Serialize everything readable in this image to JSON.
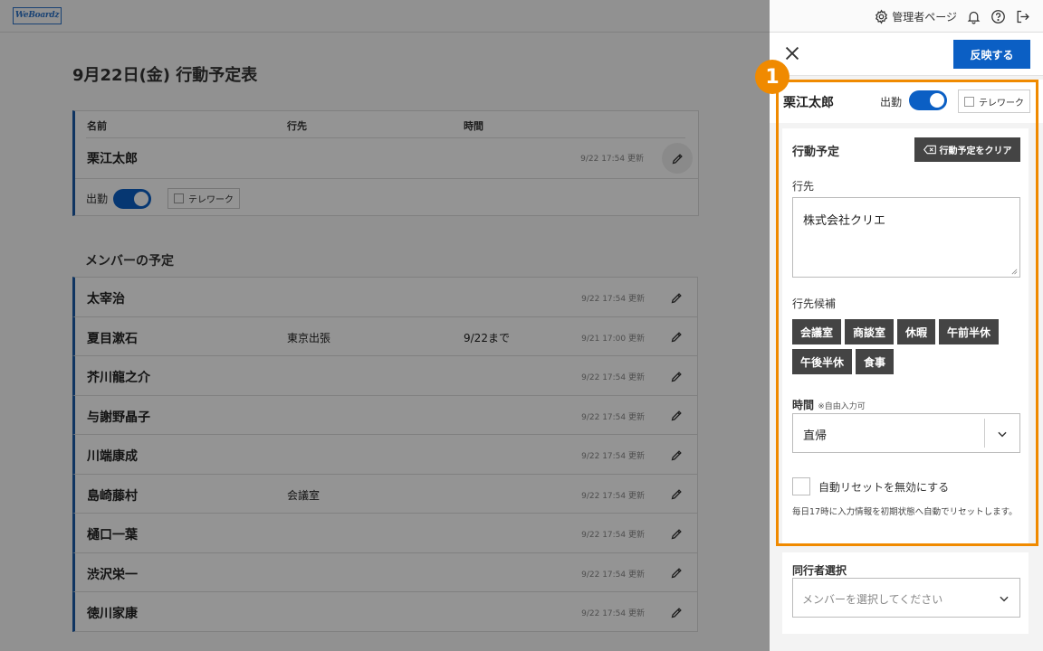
{
  "app": {
    "logo_text": "WeBoardz",
    "admin_label": "管理者ページ"
  },
  "main": {
    "title": "9月22日(金) 行動予定表",
    "columns": {
      "name": "名前",
      "destination": "行先",
      "time": "時間"
    },
    "me": {
      "name": "栗江太郎",
      "updated": "9/22 17:54 更新",
      "attend_label": "出勤",
      "telework_label": "テレワーク"
    },
    "members_title": "メンバーの予定",
    "members": [
      {
        "name": "太宰治",
        "destination": "",
        "time": "",
        "updated": "9/22 17:54 更新"
      },
      {
        "name": "夏目漱石",
        "destination": "東京出張",
        "time": "9/22まで",
        "updated": "9/21 17:00 更新"
      },
      {
        "name": "芥川龍之介",
        "destination": "",
        "time": "",
        "updated": "9/22 17:54 更新"
      },
      {
        "name": "与謝野晶子",
        "destination": "",
        "time": "",
        "updated": "9/22 17:54 更新"
      },
      {
        "name": "川端康成",
        "destination": "",
        "time": "",
        "updated": "9/22 17:54 更新"
      },
      {
        "name": "島崎藤村",
        "destination": "会議室",
        "time": "",
        "updated": "9/22 17:54 更新"
      },
      {
        "name": "樋口一葉",
        "destination": "",
        "time": "",
        "updated": "9/22 17:54 更新"
      },
      {
        "name": "渋沢栄一",
        "destination": "",
        "time": "",
        "updated": "9/22 17:54 更新"
      },
      {
        "name": "徳川家康",
        "destination": "",
        "time": "",
        "updated": "9/22 17:54 更新"
      }
    ]
  },
  "panel": {
    "apply_label": "反映する",
    "user_name": "栗江太郎",
    "attend_label": "出勤",
    "attend_on": true,
    "telework_label": "テレワーク",
    "schedule_title": "行動予定",
    "clear_label": "行動予定をクリア",
    "destination_label": "行先",
    "destination_value": "株式会社クリエ",
    "candidates_label": "行先候補",
    "candidates": [
      "会議室",
      "商談室",
      "休暇",
      "午前半休",
      "午後半休",
      "食事"
    ],
    "time_label": "時間",
    "time_note": "※自由入力可",
    "time_value": "直帰",
    "auto_reset_label": "自動リセットを無効にする",
    "auto_reset_note": "毎日17時に入力情報を初期状態へ自動でリセットします。",
    "companion_label": "同行者選択",
    "companion_placeholder": "メンバーを選択してください"
  },
  "annotation": {
    "badge": "1",
    "color": "#f08a00"
  },
  "colors": {
    "accent": "#0b5fc4",
    "row_bar": "#1a5aa8",
    "chip_bg": "#444444"
  }
}
